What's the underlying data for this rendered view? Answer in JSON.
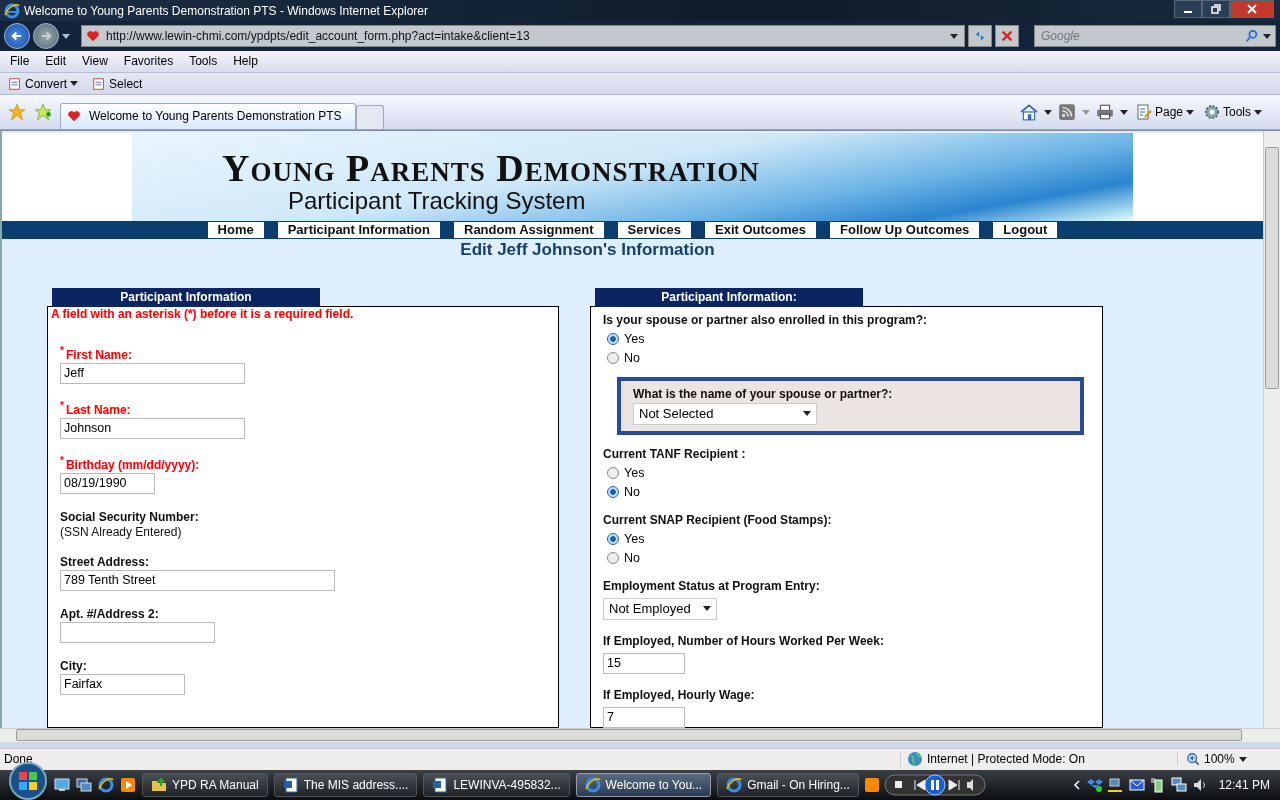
{
  "window": {
    "title": "Welcome to Young Parents Demonstration PTS - Windows Internet Explorer"
  },
  "address_bar": {
    "url": "http://www.lewin-chmi.com/ypdpts/edit_account_form.php?act=intake&client=13"
  },
  "search": {
    "placeholder": "Google"
  },
  "menu": [
    "File",
    "Edit",
    "View",
    "Favorites",
    "Tools",
    "Help"
  ],
  "command_bar": [
    "Convert",
    "Select"
  ],
  "tabs": [
    {
      "label": "Welcome to Young Parents Demonstration PTS",
      "selected": true
    }
  ],
  "toolbar": [
    "Page",
    "Tools"
  ],
  "page": {
    "banner": {
      "title": "Young Parents Demonstration",
      "subtitle": "Participant Tracking System"
    },
    "nav": [
      "Home",
      "Participant Information",
      "Random Assignment",
      "Services",
      "Exit Outcomes",
      "Follow Up Outcomes",
      "Logout"
    ],
    "heading": "Edit Jeff Johnson's Information",
    "left_panel": {
      "title": "Participant Information",
      "note": "A field with an asterisk (*) before it is a required field.",
      "fields": [
        {
          "kind": "text",
          "marker": "*",
          "label": "First Name:",
          "value": "Jeff"
        },
        {
          "kind": "text",
          "marker": "*",
          "label": "Last Name:",
          "value": "Johnson"
        },
        {
          "kind": "text",
          "marker": "*",
          "label": "Birthday (mm/dd/yyyy):",
          "value": "08/19/1990"
        },
        {
          "kind": "static",
          "label": "Social Security Number:",
          "value": "(SSN Already Entered)"
        },
        {
          "kind": "text",
          "label": "Street Address:",
          "value": "789 Tenth Street"
        },
        {
          "kind": "text",
          "label": "Apt. #/Address 2:"
        },
        {
          "kind": "text",
          "label": "City:",
          "value": "Fairfax"
        }
      ]
    },
    "right_panel": {
      "title": "Participant Information:",
      "fields": [
        {
          "kind": "radio",
          "label": "Is your spouse or partner also enrolled in this program?:",
          "options": [
            {
              "label": "Yes",
              "selected": true
            },
            {
              "label": "No",
              "selected": false
            }
          ]
        },
        {
          "kind": "group",
          "label": "What is the name of your spouse or partner?:",
          "value": "Not Selected"
        },
        {
          "kind": "radio",
          "label": "Current TANF Recipient :",
          "options": [
            {
              "label": "Yes",
              "selected": false
            },
            {
              "label": "No",
              "selected": true
            }
          ]
        },
        {
          "kind": "radio",
          "label": "Current SNAP Recipient (Food Stamps):",
          "options": [
            {
              "label": "Yes",
              "selected": true
            },
            {
              "label": "No",
              "selected": false
            }
          ]
        },
        {
          "kind": "select",
          "label": "Employment Status at Program Entry:",
          "value": "Not Employed"
        },
        {
          "kind": "text",
          "label": "If Employed, Number of Hours Worked Per Week:",
          "value": "15"
        },
        {
          "kind": "text",
          "label": "If Employed, Hourly Wage:",
          "value": "7"
        }
      ]
    }
  },
  "status_bar": {
    "status": "Done",
    "zone": "Internet | Protected Mode: On",
    "zoom": "100%"
  },
  "taskbar": {
    "tasks": [
      {
        "label": "YPD RA Manual",
        "kind": "folder",
        "selected": false
      },
      {
        "label": "The MIS address....",
        "kind": "word",
        "selected": false
      },
      {
        "label": "LEWINVA-495832...",
        "kind": "word",
        "selected": false
      },
      {
        "label": "Welcome to You...",
        "kind": "ie",
        "selected": true
      },
      {
        "label": "Gmail - On Hiring...",
        "kind": "ie",
        "selected": false
      }
    ],
    "clock": "12:41 PM"
  }
}
